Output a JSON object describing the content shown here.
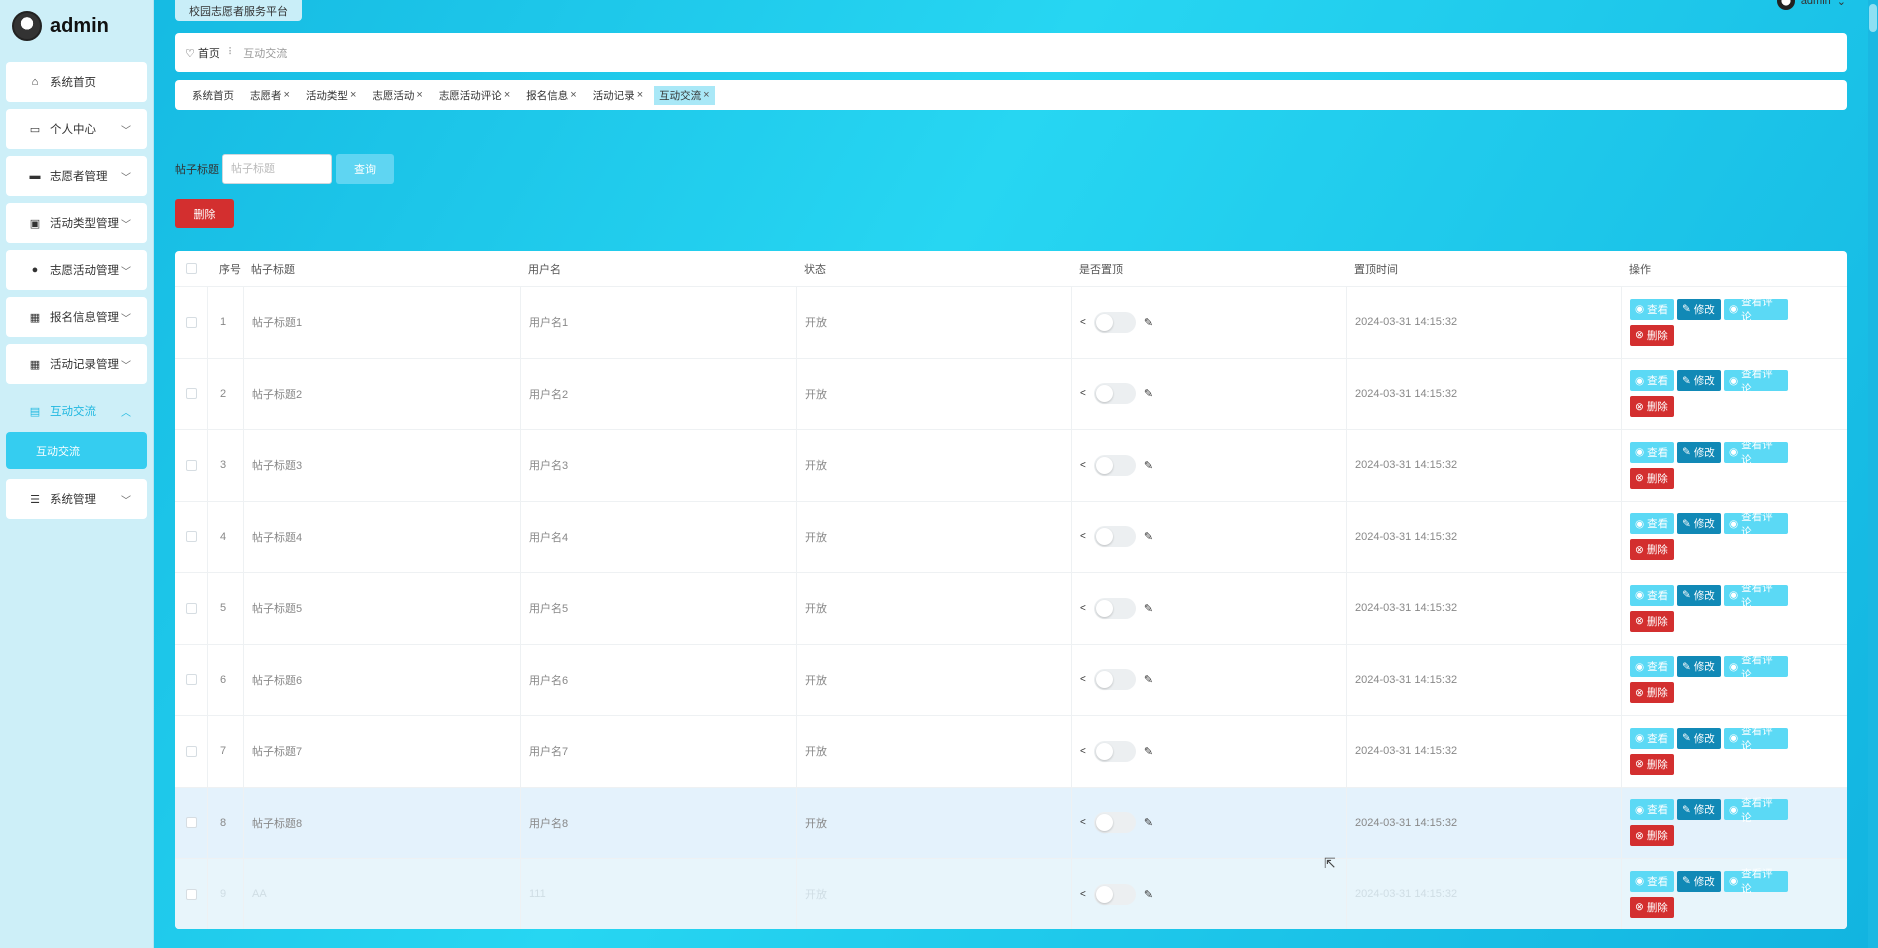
{
  "brand": {
    "name": "admin"
  },
  "topbar": {
    "title": "校园志愿者服务平台",
    "user": "admin"
  },
  "sidebar": {
    "items": [
      {
        "label": "系统首页",
        "icon": "home-icon",
        "glyph": "⌂",
        "chevron": false
      },
      {
        "label": "个人中心",
        "icon": "calendar-icon",
        "glyph": "▭",
        "chevron": true
      },
      {
        "label": "志愿者管理",
        "icon": "briefcase-icon",
        "glyph": "▬",
        "chevron": true
      },
      {
        "label": "活动类型管理",
        "icon": "trash-icon",
        "glyph": "▣",
        "chevron": true
      },
      {
        "label": "志愿活动管理",
        "icon": "user-icon",
        "glyph": "●",
        "chevron": true
      },
      {
        "label": "报名信息管理",
        "icon": "grid-icon",
        "glyph": "▦",
        "chevron": true
      },
      {
        "label": "活动记录管理",
        "icon": "grid-icon",
        "glyph": "▦",
        "chevron": true
      },
      {
        "label": "互动交流",
        "icon": "forum-icon",
        "glyph": "▤",
        "chevron": true,
        "active": true
      },
      {
        "label": "系统管理",
        "icon": "list-icon",
        "glyph": "☰",
        "chevron": true
      }
    ],
    "active_sub": "互动交流"
  },
  "breadcrumb": {
    "home": "首页",
    "current": "互动交流"
  },
  "tags": [
    {
      "label": "系统首页",
      "closable": false,
      "active": false
    },
    {
      "label": "志愿者",
      "closable": true,
      "active": false
    },
    {
      "label": "活动类型",
      "closable": true,
      "active": false
    },
    {
      "label": "志愿活动",
      "closable": true,
      "active": false
    },
    {
      "label": "志愿活动评论",
      "closable": true,
      "active": false
    },
    {
      "label": "报名信息",
      "closable": true,
      "active": false
    },
    {
      "label": "活动记录",
      "closable": true,
      "active": false
    },
    {
      "label": "互动交流",
      "closable": true,
      "active": true
    }
  ],
  "search": {
    "label": "帖子标题",
    "placeholder": "帖子标题",
    "value": "",
    "query_label": "查询"
  },
  "delete_label": "删除",
  "table": {
    "headers": {
      "index": "序号",
      "title": "帖子标题",
      "user": "用户名",
      "status": "状态",
      "pinned": "是否置顶",
      "time": "置顶时间",
      "ops": "操作"
    },
    "ops_labels": {
      "view": "查看",
      "edit": "修改",
      "comments": "查看评论",
      "del": "删除"
    },
    "rows": [
      {
        "index": "1",
        "title": "帖子标题1",
        "user": "用户名1",
        "status": "开放",
        "time": "2024-03-31 14:15:32"
      },
      {
        "index": "2",
        "title": "帖子标题2",
        "user": "用户名2",
        "status": "开放",
        "time": "2024-03-31 14:15:32"
      },
      {
        "index": "3",
        "title": "帖子标题3",
        "user": "用户名3",
        "status": "开放",
        "time": "2024-03-31 14:15:32"
      },
      {
        "index": "4",
        "title": "帖子标题4",
        "user": "用户名4",
        "status": "开放",
        "time": "2024-03-31 14:15:32"
      },
      {
        "index": "5",
        "title": "帖子标题5",
        "user": "用户名5",
        "status": "开放",
        "time": "2024-03-31 14:15:32"
      },
      {
        "index": "6",
        "title": "帖子标题6",
        "user": "用户名6",
        "status": "开放",
        "time": "2024-03-31 14:15:32"
      },
      {
        "index": "7",
        "title": "帖子标题7",
        "user": "用户名7",
        "status": "开放",
        "time": "2024-03-31 14:15:32"
      },
      {
        "index": "8",
        "title": "帖子标题8",
        "user": "用户名8",
        "status": "开放",
        "time": "2024-03-31 14:15:32",
        "hover": true
      },
      {
        "index": "9",
        "title": "AA",
        "user": "111",
        "status": "开放",
        "time": "2024-03-31 14:15:32",
        "faded": true
      }
    ]
  },
  "colors": {
    "accent": "#21b8e0",
    "view_button": "#5bd9f5",
    "edit_button": "#1189b6",
    "delete_button": "#d32f2f"
  }
}
